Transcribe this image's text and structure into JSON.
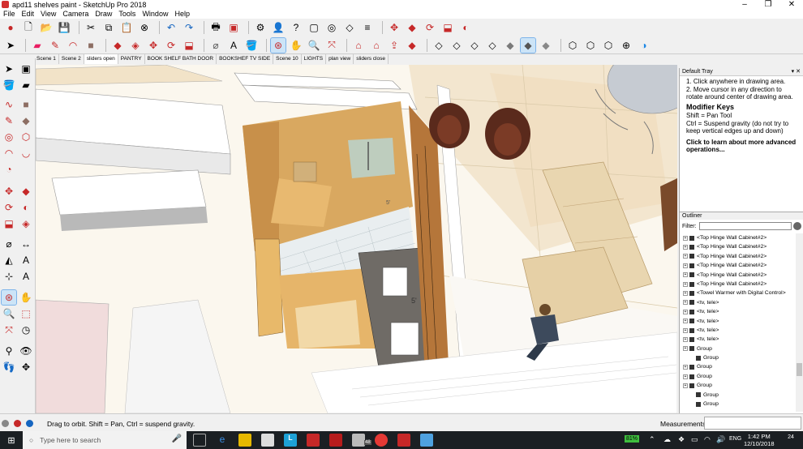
{
  "window": {
    "title": "apd11 shelves paint - SketchUp Pro 2018",
    "controls": [
      "–",
      "❐",
      "✕"
    ]
  },
  "menu": [
    "File",
    "Edit",
    "View",
    "Camera",
    "Draw",
    "Tools",
    "Window",
    "Help"
  ],
  "scenes": [
    {
      "label": "Scene 1",
      "active": false
    },
    {
      "label": "Scene 2",
      "active": false
    },
    {
      "label": "sliders open",
      "active": true
    },
    {
      "label": "PANTRY",
      "active": false
    },
    {
      "label": "BOOK SHELF BATH DOOR",
      "active": false
    },
    {
      "label": "BOOKSHEF TV SIDE",
      "active": false
    },
    {
      "label": "Scene 10",
      "active": false
    },
    {
      "label": "LIGHTS",
      "active": false
    },
    {
      "label": "plan view",
      "active": false
    },
    {
      "label": "sliders close",
      "active": false
    }
  ],
  "tray": {
    "title": "Default Tray",
    "controls": "▾ ✕",
    "instructions": [
      "1. Click anywhere in drawing area.",
      "2. Move cursor in any direction to rotate around center of drawing area."
    ],
    "modifier_heading": "Modifier Keys",
    "modifiers": [
      "Shift = Pan Tool",
      "Ctrl = Suspend gravity (do not try to keep vertical edges up and down)"
    ],
    "learn_more": "Click to learn about more advanced operations..."
  },
  "outliner": {
    "title": "Outliner",
    "filter_label": "Filter:",
    "items": [
      {
        "label": "<Top Hinge Wall Cabinet#2>",
        "child": false
      },
      {
        "label": "<Top Hinge Wall Cabinet#2>",
        "child": false
      },
      {
        "label": "<Top Hinge Wall Cabinet#2>",
        "child": false
      },
      {
        "label": "<Top Hinge Wall Cabinet#2>",
        "child": false
      },
      {
        "label": "<Top Hinge Wall Cabinet#2>",
        "child": false
      },
      {
        "label": "<Top Hinge Wall Cabinet#2>",
        "child": false
      },
      {
        "label": "<Towel Warmer with Digital Control>",
        "child": false
      },
      {
        "label": "<tv, tele>",
        "child": false
      },
      {
        "label": "<tv, tele>",
        "child": false
      },
      {
        "label": "<tv, tele>",
        "child": false
      },
      {
        "label": "<tv, tele>",
        "child": false
      },
      {
        "label": "<tv, tele>",
        "child": false
      },
      {
        "label": "Group",
        "child": false
      },
      {
        "label": "Group",
        "child": true
      },
      {
        "label": "Group",
        "child": false
      },
      {
        "label": "Group",
        "child": false
      },
      {
        "label": "Group",
        "child": false
      },
      {
        "label": "Group",
        "child": true
      },
      {
        "label": "Group",
        "child": true
      }
    ]
  },
  "status": {
    "message": "Drag to orbit. Shift = Pan, Ctrl = suspend gravity.",
    "measurements_label": "Measurements"
  },
  "taskbar": {
    "search_placeholder": "Type here to search",
    "battery": "81%",
    "language": "ENG",
    "time": "1:42 PM",
    "date": "12/10/2018",
    "notifications": "24",
    "mail_badge": "48"
  },
  "viewport": {
    "dimension_label": "5'",
    "dimension_label_2": "5'"
  },
  "colors": {
    "selection": "#cce4f7",
    "taskbar": "#1b1f23",
    "wood": "#d9a860",
    "counter": "#6f6b66",
    "sofa": "#e9d6b0",
    "chair": "#5a2a1c"
  }
}
